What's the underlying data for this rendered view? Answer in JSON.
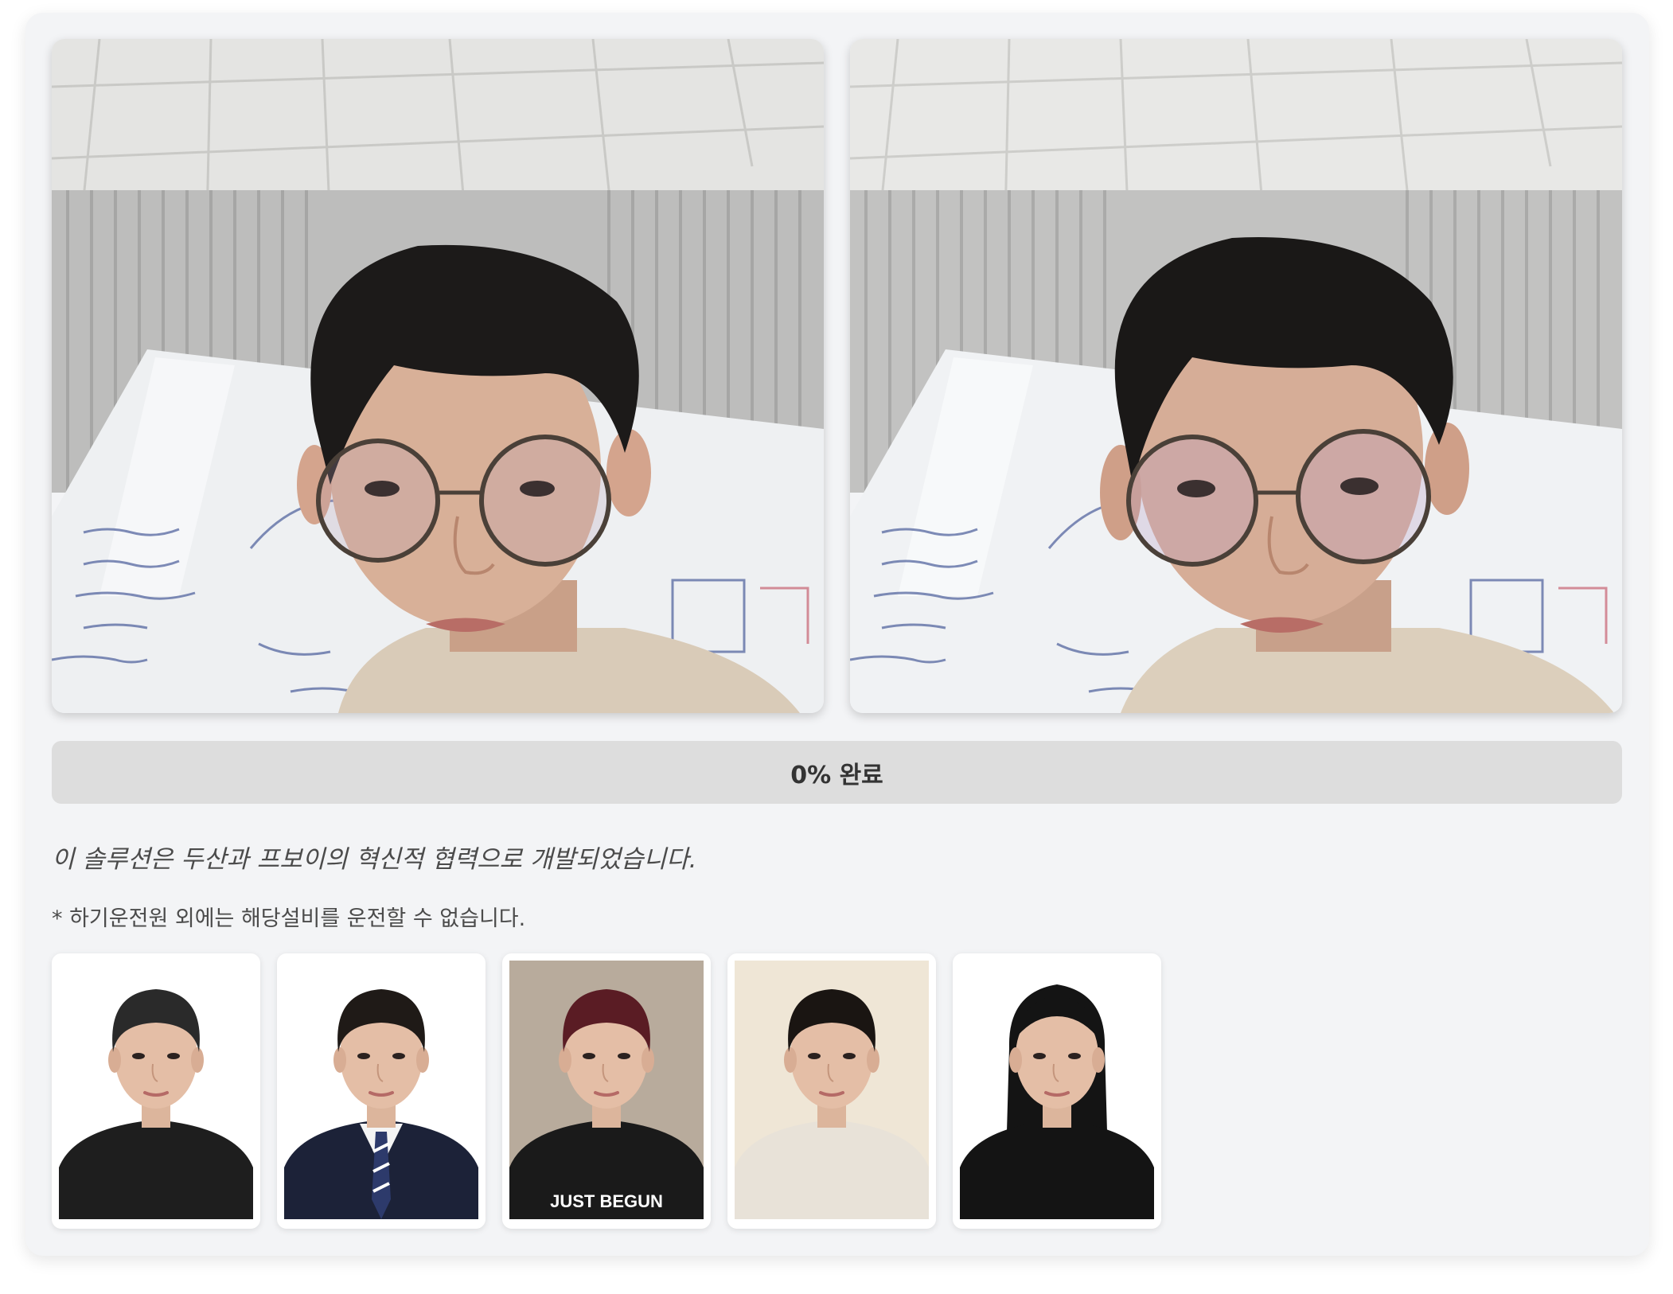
{
  "video": {
    "left_label": "camera-feed",
    "right_label": "processed-feed"
  },
  "progress": {
    "percent": 0,
    "label": "0% 완료"
  },
  "credit_text": "이 솔루션은 두산과 프보이의 혁신적 협력으로 개발되었습니다.",
  "notice_text": "* 하기운전원 외에는 해당설비를 운전할 수 없습니다.",
  "thumbnails": [
    {
      "name": "photo-1",
      "bg": "#ffffff",
      "hair": "#2a2a2a",
      "shirt": "#1e1e1e",
      "long_hair": false
    },
    {
      "name": "photo-2",
      "bg": "#ffffff",
      "hair": "#1f1a17",
      "shirt": "#1c2238",
      "long_hair": false,
      "suit": true
    },
    {
      "name": "photo-3",
      "bg": "#b8ab9c",
      "hair": "#5a1c24",
      "shirt": "#1a1a1a",
      "long_hair": false,
      "shirt_text": "JUST BEGUN"
    },
    {
      "name": "photo-4",
      "bg": "#efe6d6",
      "hair": "#1a1512",
      "shirt": "#e8e2d8",
      "long_hair": false
    },
    {
      "name": "photo-5",
      "bg": "#ffffff",
      "hair": "#141414",
      "shirt": "#141414",
      "long_hair": true
    }
  ]
}
